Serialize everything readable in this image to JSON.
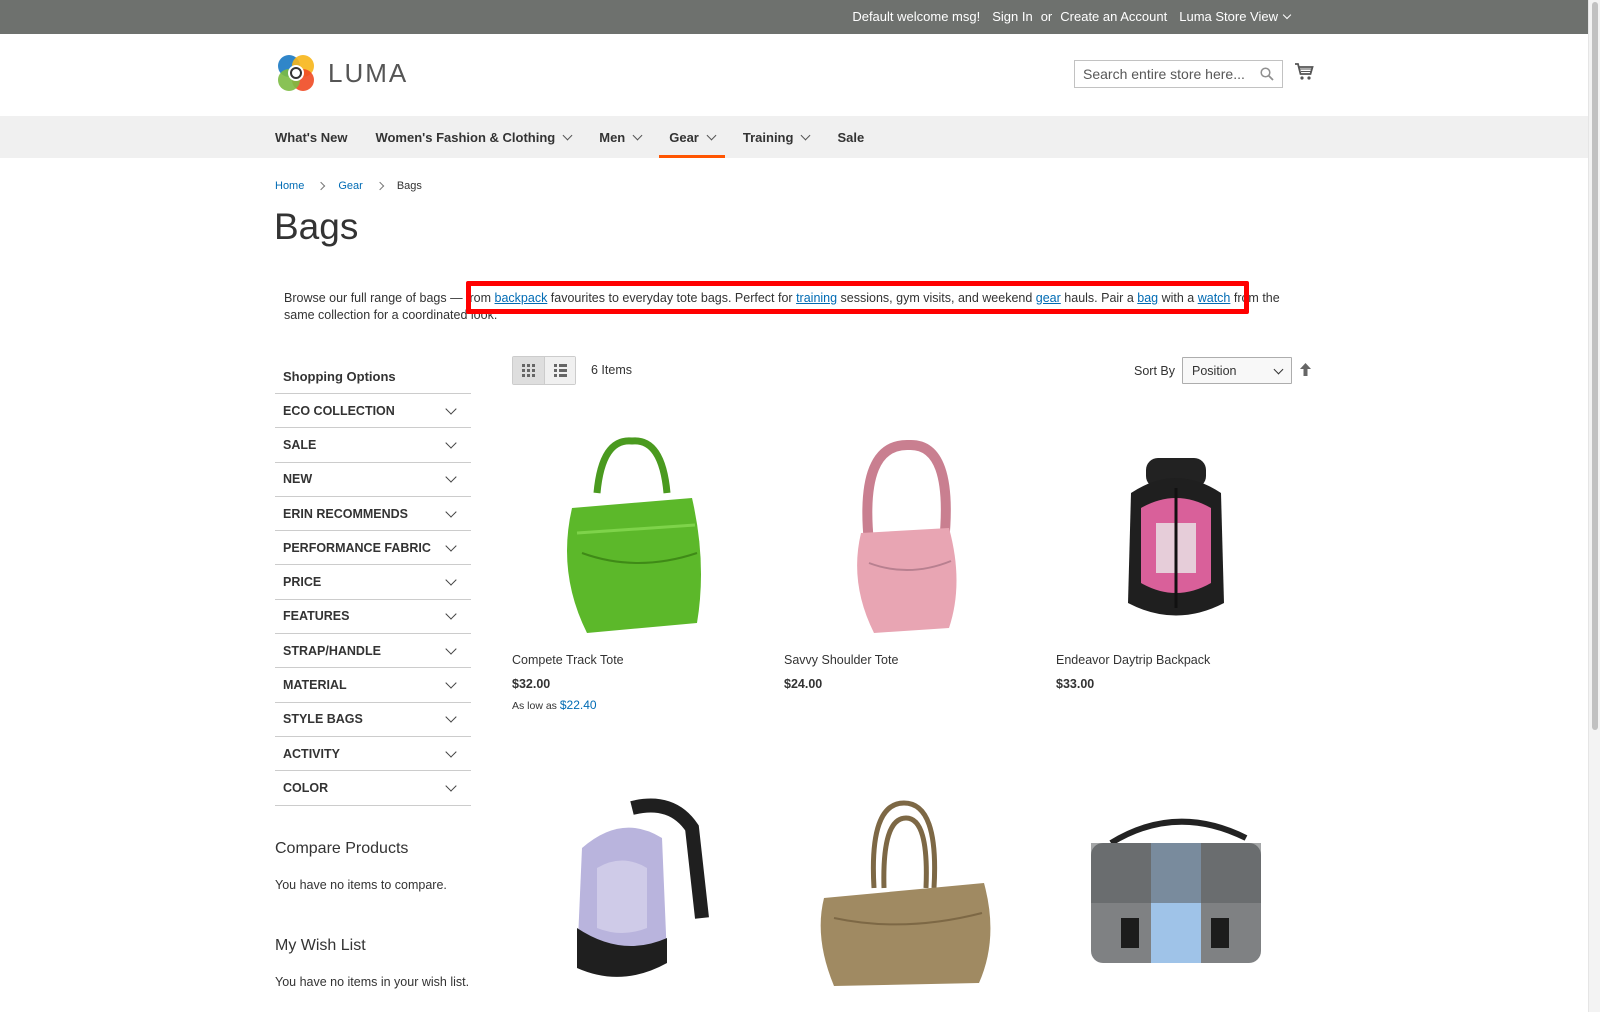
{
  "topbar": {
    "welcome": "Default welcome msg!",
    "sign_in": "Sign In",
    "or": "or",
    "create_account": "Create an Account",
    "store_view": "Luma Store View"
  },
  "header": {
    "logo_text": "LUMA",
    "search_placeholder": "Search entire store here...",
    "icons": [
      "search-icon",
      "cart-icon"
    ]
  },
  "nav": {
    "items": [
      {
        "label": "What's New",
        "dropdown": false
      },
      {
        "label": "Women's Fashion & Clothing",
        "dropdown": true
      },
      {
        "label": "Men",
        "dropdown": true
      },
      {
        "label": "Gear",
        "dropdown": true,
        "active": true
      },
      {
        "label": "Training",
        "dropdown": true
      },
      {
        "label": "Sale",
        "dropdown": false
      }
    ],
    "active_color": "#ff5501"
  },
  "breadcrumb": [
    "Home",
    "Gear",
    "Bags"
  ],
  "page_title": "Bags",
  "description": {
    "p1": "Browse our full range of bags — from ",
    "l1": "backpack",
    "p2": " favourites to everyday tote bags. Perfect for ",
    "l2": "training",
    "p3": " sessions, gym visits, and weekend ",
    "l3": "gear",
    "p4": " hauls. Pair a ",
    "l4": "bag",
    "p5": " with a ",
    "l5": "watch",
    "p6": " from the same collection for a coordinated look."
  },
  "sidebar": {
    "title": "Shopping Options",
    "filters": [
      "ECO COLLECTION",
      "SALE",
      "NEW",
      "ERIN RECOMMENDS",
      "PERFORMANCE FABRIC",
      "PRICE",
      "FEATURES",
      "STRAP/HANDLE",
      "MATERIAL",
      "STYLE BAGS",
      "ACTIVITY",
      "COLOR"
    ],
    "compare_title": "Compare Products",
    "compare_empty": "You have no items to compare.",
    "wishlist_title": "My Wish List",
    "wishlist_empty": "You have no items in your wish list."
  },
  "toolbar": {
    "count": "6 Items",
    "sort_label": "Sort By",
    "sort_value": "Position"
  },
  "products": [
    {
      "name": "Compete Track Tote",
      "price": "$32.00",
      "as_low_label": "As low as",
      "as_low_value": "$22.40",
      "image_color": "#5cb82a"
    },
    {
      "name": "Savvy Shoulder Tote",
      "price": "$24.00",
      "image_color": "#e8a5b3"
    },
    {
      "name": "Endeavor Daytrip Backpack",
      "price": "$33.00",
      "image_color": "#d9609a"
    },
    {
      "name": "",
      "price": "",
      "image_color": "#b9b4dd"
    },
    {
      "name": "",
      "price": "",
      "image_color": "#a08a62"
    },
    {
      "name": "",
      "price": "",
      "image_color": "#9fc3e8"
    }
  ],
  "colors": {
    "link": "#006bb4",
    "highlight": "#ff0000",
    "topbar": "#6e716e"
  }
}
